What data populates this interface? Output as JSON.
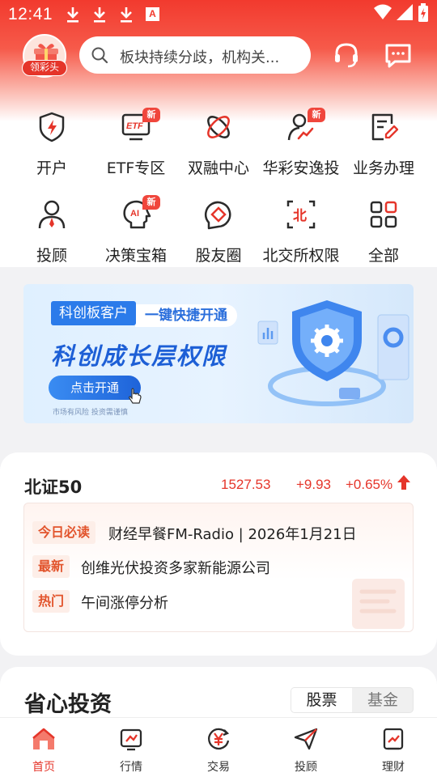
{
  "status_bar": {
    "time": "12:41",
    "a_badge": "A"
  },
  "header": {
    "avatar_badge": "领彩头",
    "search_placeholder": "板块持续分歧，机构关..."
  },
  "grid": [
    {
      "label": "开户",
      "icon": "shield-lightning-icon",
      "new": false
    },
    {
      "label": "ETF专区",
      "icon": "etf-icon",
      "new": true,
      "badge": "新"
    },
    {
      "label": "双融中心",
      "icon": "dual-finance-icon",
      "new": false
    },
    {
      "label": "华彩安逸投",
      "icon": "advisor-chart-icon",
      "new": true,
      "badge": "新"
    },
    {
      "label": "业务办理",
      "icon": "document-edit-icon",
      "new": false
    },
    {
      "label": "投顾",
      "icon": "person-tie-icon",
      "new": false
    },
    {
      "label": "决策宝箱",
      "icon": "ai-head-icon",
      "new": true,
      "badge": "新"
    },
    {
      "label": "股友圈",
      "icon": "circle-diamond-icon",
      "new": false
    },
    {
      "label": "北交所权限",
      "icon": "bei-exchange-icon",
      "new": false
    },
    {
      "label": "全部",
      "icon": "grid-all-icon",
      "new": false
    }
  ],
  "banner": {
    "tag1": "科创板客户",
    "tag2": "一键快捷开通",
    "title": "科创成长层权限",
    "button": "点击开通",
    "note": "市场有风险  投资需谨慎"
  },
  "index": {
    "name": "北证50",
    "value": "1527.53",
    "change": "+9.93",
    "change_pct": "+0.65%",
    "trend": "up",
    "color": "#e5352a"
  },
  "news": [
    {
      "tag": "今日必读",
      "text": "财经早餐FM-Radio | 2026年1月21日"
    },
    {
      "tag": "最新",
      "text": "创维光伏投资多家新能源公司"
    },
    {
      "tag": "热门",
      "text": "午间涨停分析"
    }
  ],
  "section": {
    "title": "省心投资",
    "seg_options": [
      "股票",
      "基金"
    ],
    "seg_selected": "股票"
  },
  "bottom_nav": [
    {
      "label": "首页",
      "icon": "home-icon",
      "active": true
    },
    {
      "label": "行情",
      "icon": "market-chart-icon",
      "active": false
    },
    {
      "label": "交易",
      "icon": "yen-trade-icon",
      "active": false
    },
    {
      "label": "投顾",
      "icon": "paper-plane-icon",
      "active": false
    },
    {
      "label": "理财",
      "icon": "wealth-icon",
      "active": false
    }
  ],
  "colors": {
    "brand_red": "#e5352a",
    "banner_blue": "#2b7bea"
  }
}
